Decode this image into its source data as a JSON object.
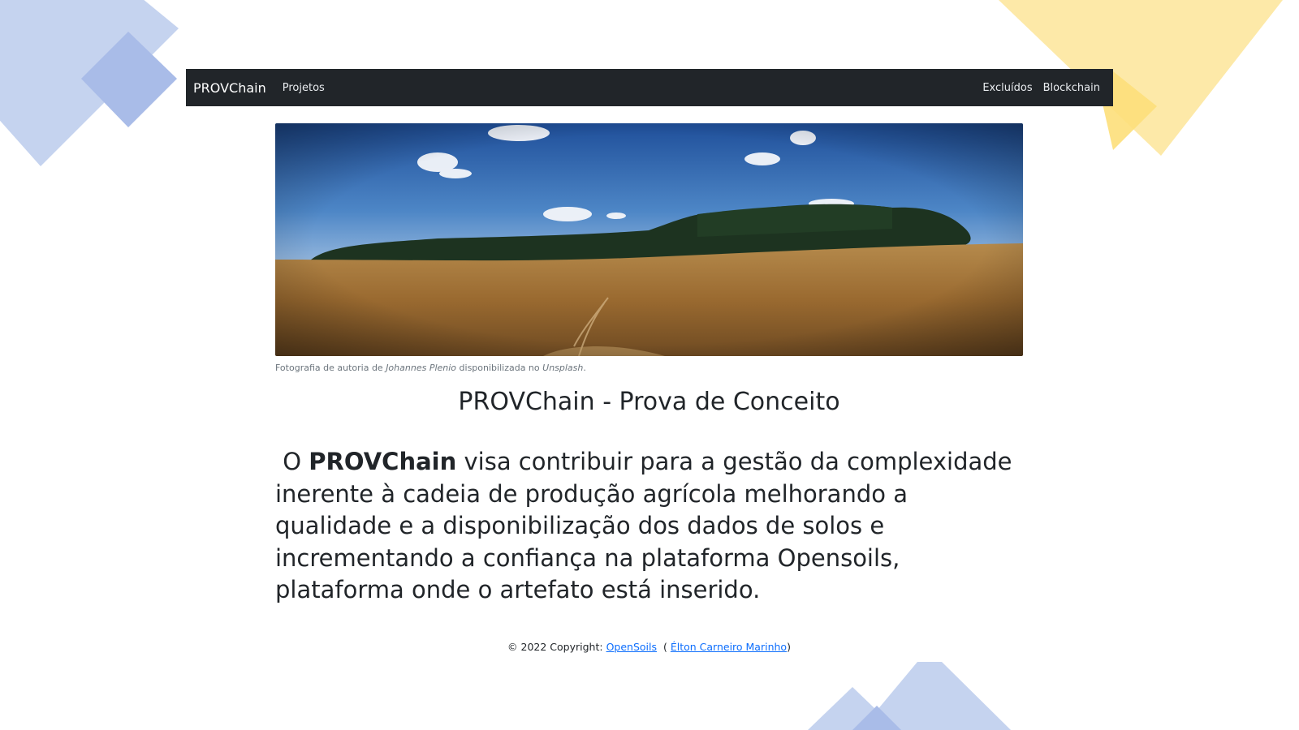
{
  "navbar": {
    "brand": "PROVChain",
    "links_left": [
      "Projetos"
    ],
    "links_right": [
      "Excluídos",
      "Blockchain"
    ]
  },
  "hero_image": {
    "caption_prefix": "Fotografia de autoria de",
    "author": "Johannes Plenio",
    "caption_middle": "disponibilizada no",
    "source": "Unsplash",
    "caption_end": "."
  },
  "main": {
    "title": "PROVChain - Prova de Conceito",
    "lead_prefix": "O",
    "lead_bold": "PROVChain",
    "lead_rest": "visa contribuir para a gestão da complexidade inerente à cadeia de produção agrícola melhorando a qualidade e a disponibilização dos dados de solos e incrementando a confiança na plataforma Opensoils, plataforma onde o artefato está inserido."
  },
  "footer": {
    "copyright": "© 2022 Copyright:",
    "link1": "OpenSoils",
    "open_paren": "(",
    "link2": "Élton Carneiro Marinho",
    "close_paren": ")"
  },
  "colors": {
    "navbar_bg": "#212529",
    "link": "#0d6efd",
    "deco_blue": "#c5d3ef",
    "deco_yellow": "#fde9a8"
  }
}
